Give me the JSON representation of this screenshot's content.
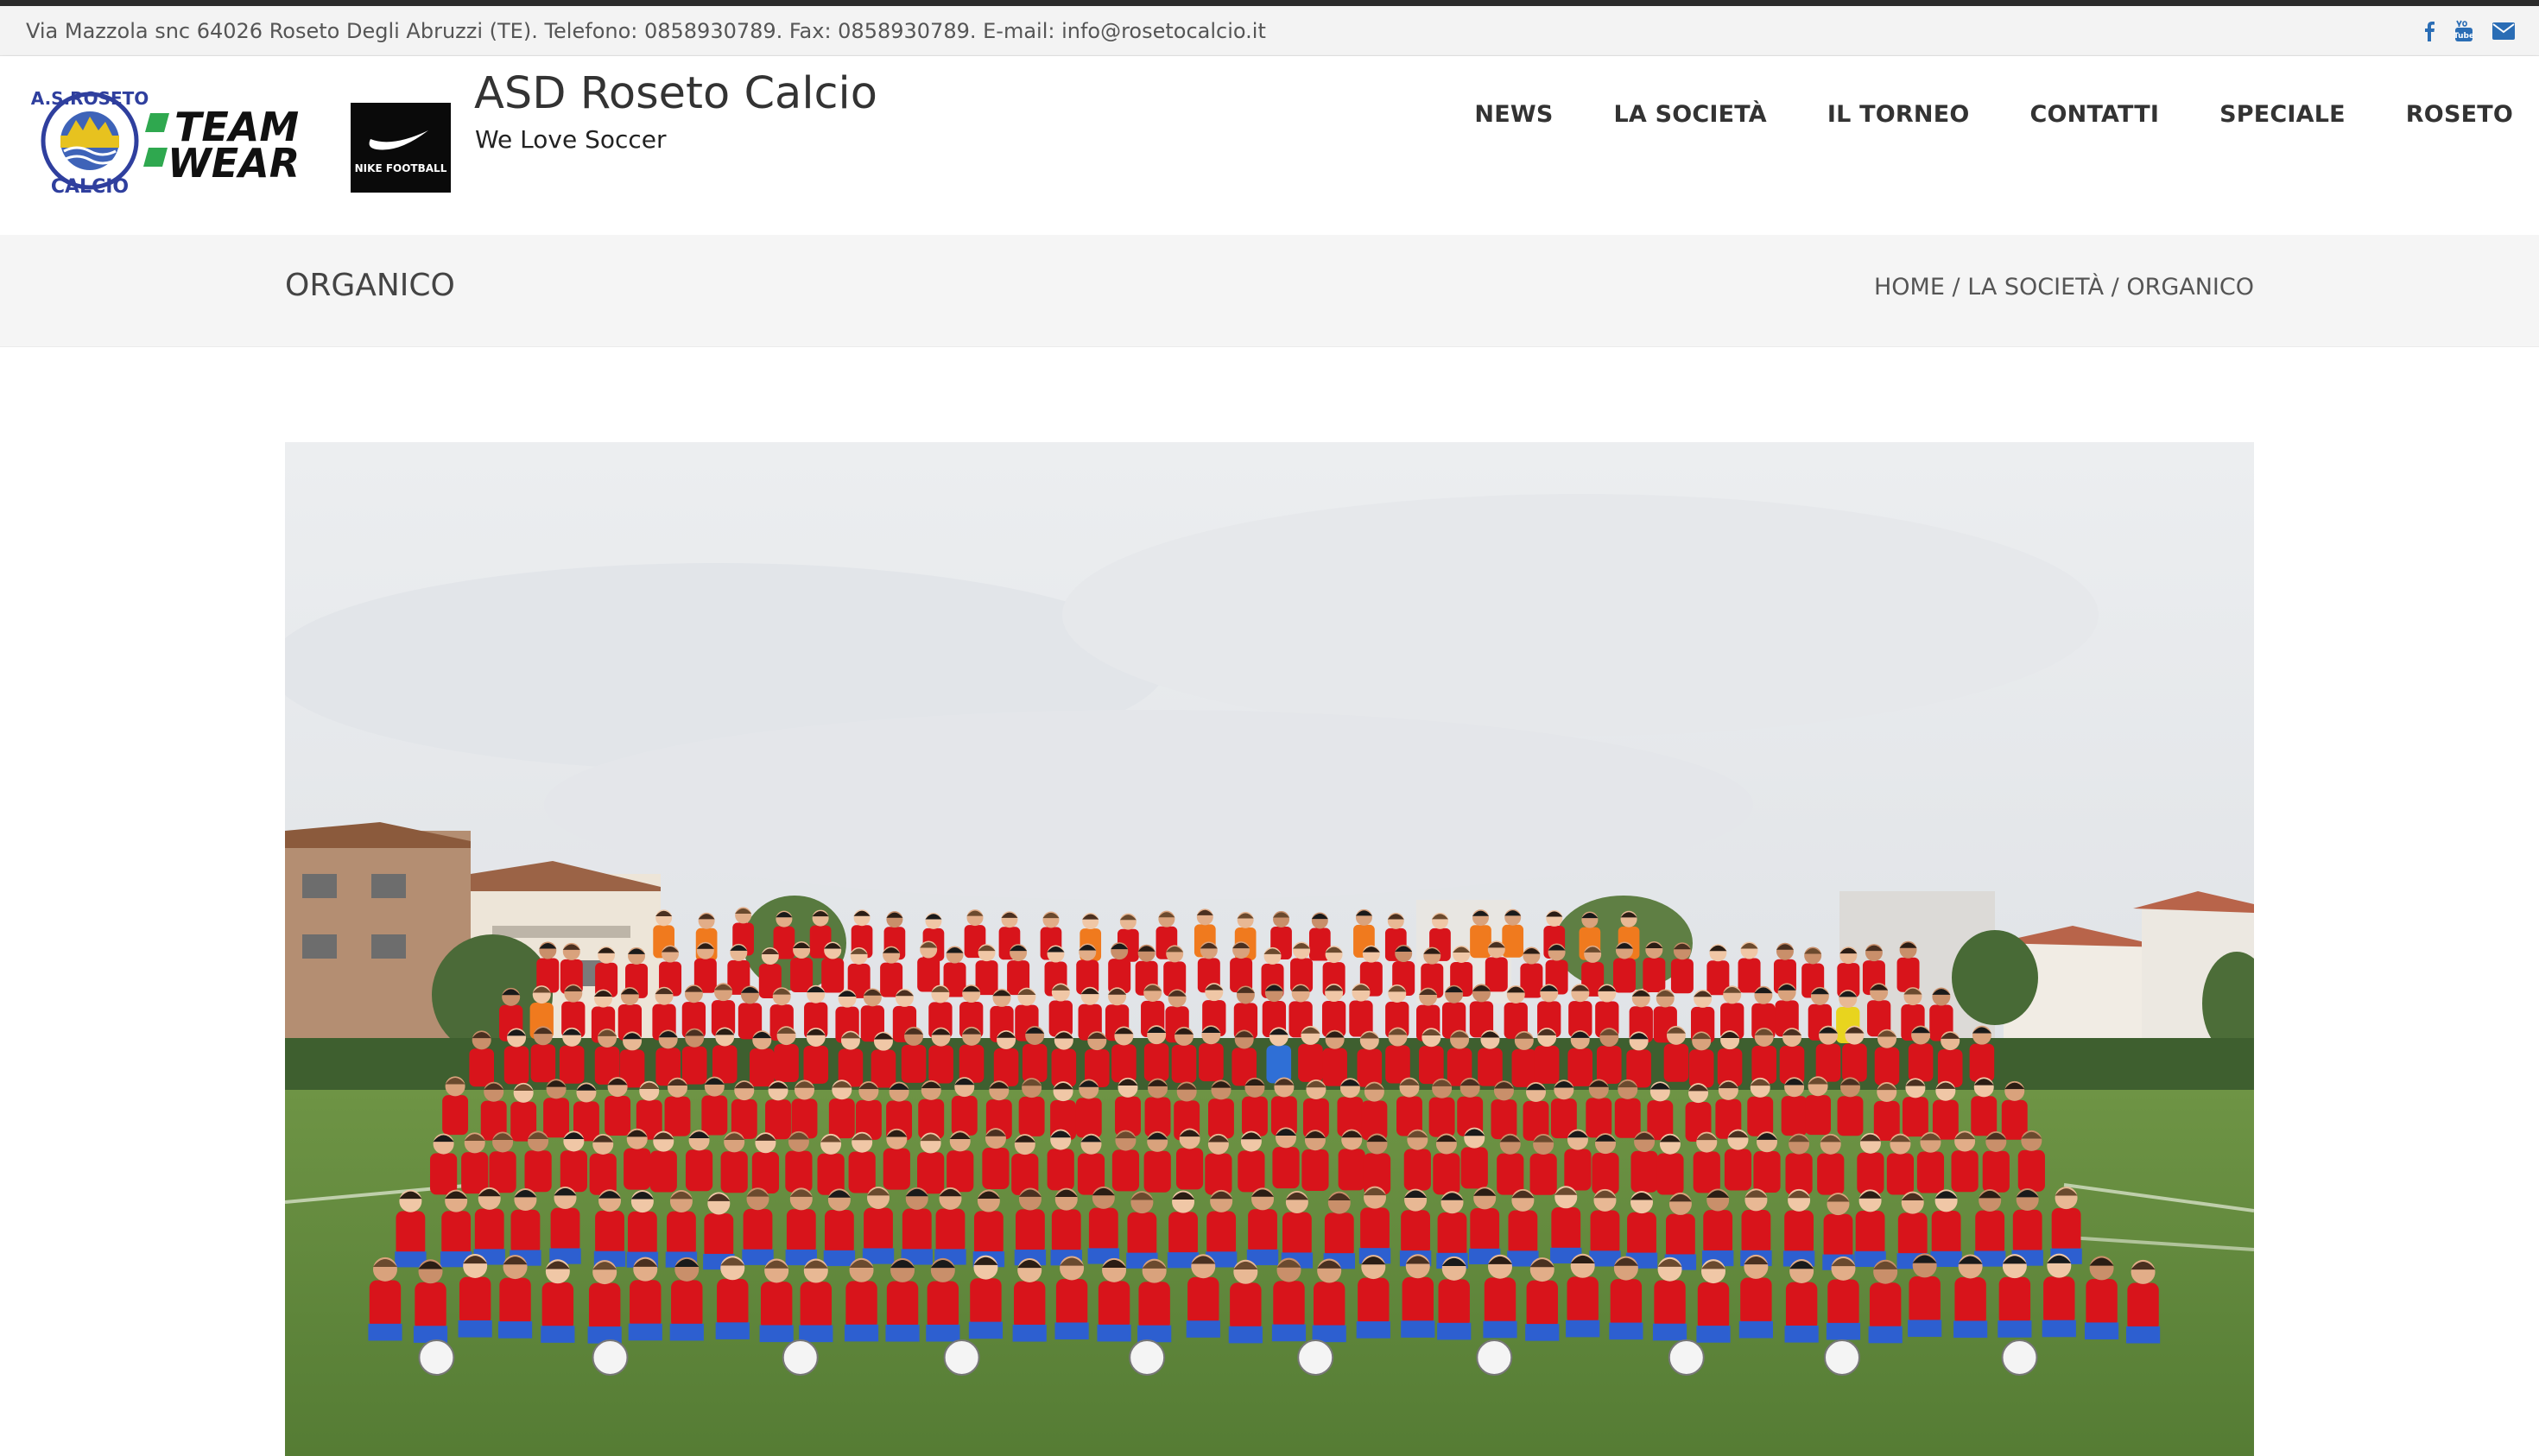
{
  "topbar": {
    "contact_text": "Via Mazzola snc 64026 Roseto Degli Abruzzi (TE). Telefono: 0858930789. Fax: 0858930789. E-mail: info@rosetocalcio.it",
    "social": [
      "facebook-icon",
      "youtube-icon",
      "envelope-icon"
    ],
    "social_color": "#2a6db5"
  },
  "header": {
    "site_title": "ASD Roseto Calcio",
    "tagline": "We Love Soccer",
    "logo_texts": {
      "club_top": "A.S.ROSETO",
      "club_bottom": "CALCIO",
      "team_line1": "TEAM",
      "team_line2": "WEAR",
      "nike": "NIKE FOOTBALL"
    },
    "nav": [
      "NEWS",
      "LA SOCIETÀ",
      "IL TORNEO",
      "CONTATTI",
      "SPECIALE",
      "ROSETO"
    ]
  },
  "titlebar": {
    "page_title": "ORGANICO",
    "breadcrumb": [
      "HOME",
      "LA SOCIETÀ",
      "ORGANICO"
    ],
    "separator": "/"
  },
  "colors": {
    "kit_red": "#d8141b",
    "staff_orange": "#f07a1e",
    "grass": "#5f8a3a",
    "sky": "#e9ebee"
  }
}
